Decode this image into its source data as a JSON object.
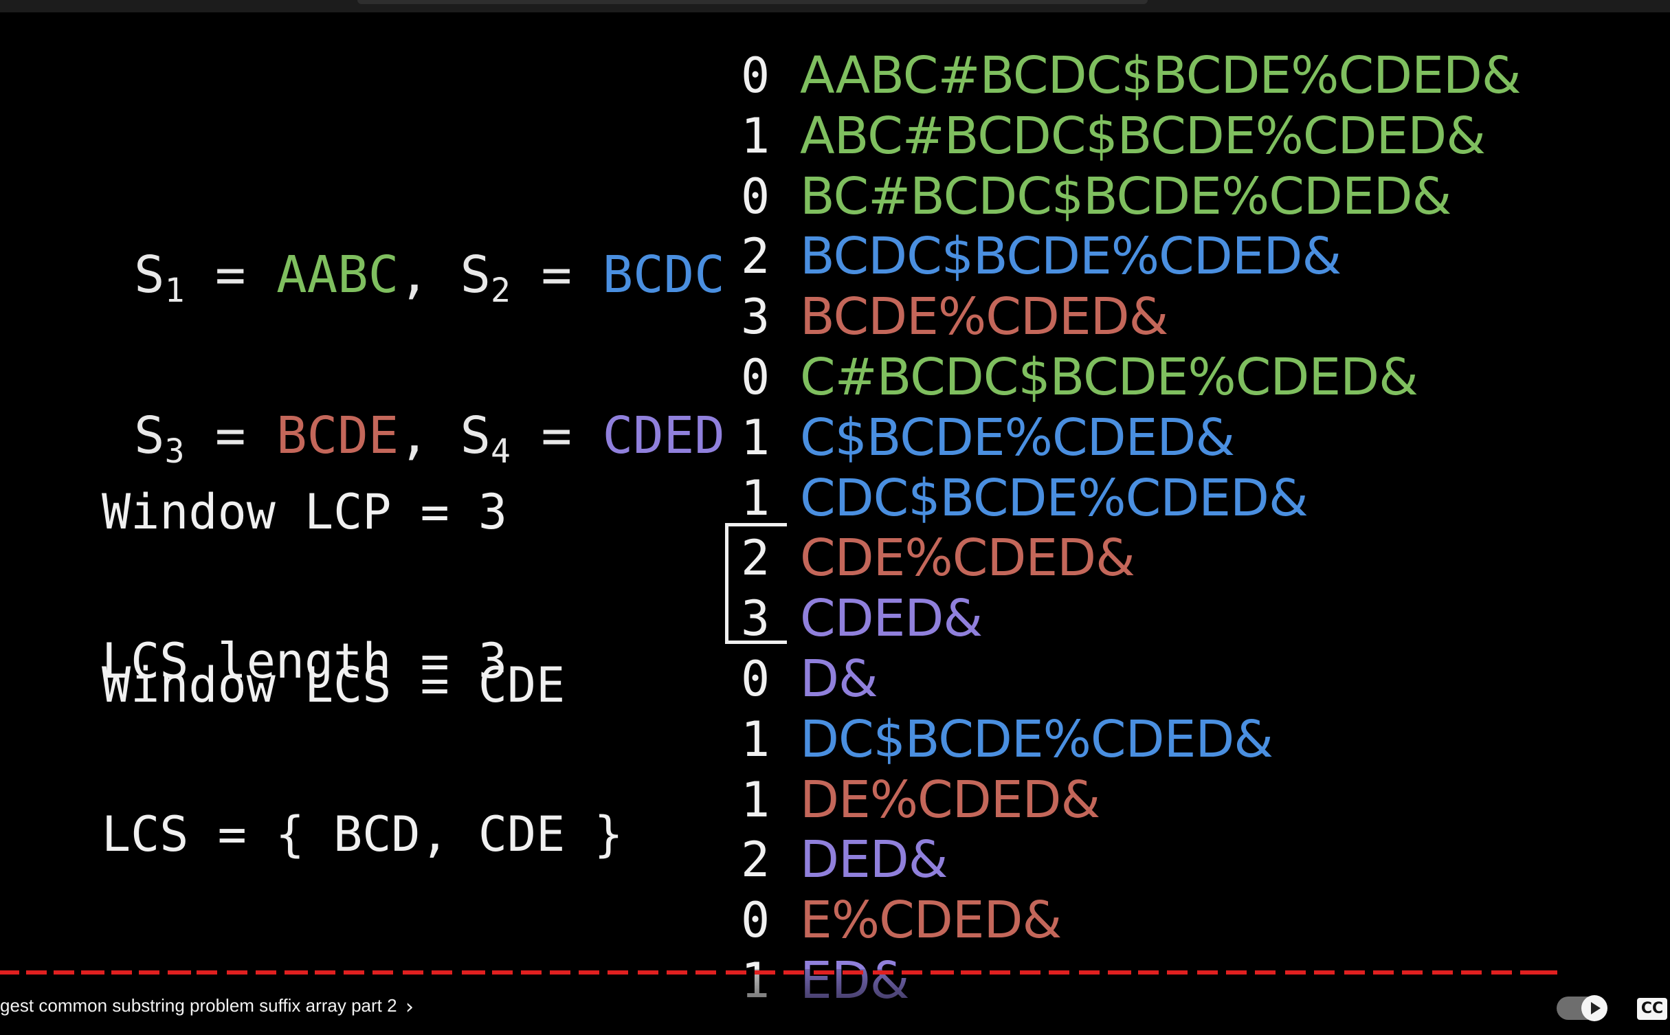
{
  "definitions": [
    {
      "left": {
        "name": "S",
        "index": "1",
        "value": "AABC",
        "color": "#7fbf5f"
      },
      "right": {
        "name": "S",
        "index": "2",
        "value": "BCDC",
        "color": "#4a8fe0"
      }
    },
    {
      "left": {
        "name": "S",
        "index": "3",
        "value": "BCDE",
        "color": "#c4675a"
      },
      "right": {
        "name": "S",
        "index": "4",
        "value": "CDED",
        "color": "#9080dc"
      }
    }
  ],
  "window": {
    "lcp_line": "Window LCP = 3",
    "lcs_line": "Window LCS = CDE"
  },
  "result": {
    "length_line": "LCS length = 3",
    "set_line": "LCS = { BCD, CDE }"
  },
  "suffix_table": [
    {
      "lcp": "0",
      "suffix": "AABC#BCDC$BCDE%CDED&",
      "color": "#7fbf5f"
    },
    {
      "lcp": "1",
      "suffix": "ABC#BCDC$BCDE%CDED&",
      "color": "#7fbf5f"
    },
    {
      "lcp": "0",
      "suffix": "BC#BCDC$BCDE%CDED&",
      "color": "#7fbf5f"
    },
    {
      "lcp": "2",
      "suffix": "BCDC$BCDE%CDED&",
      "color": "#4a8fe0"
    },
    {
      "lcp": "3",
      "suffix": "BCDE%CDED&",
      "color": "#c4675a"
    },
    {
      "lcp": "0",
      "suffix": "C#BCDC$BCDE%CDED&",
      "color": "#7fbf5f"
    },
    {
      "lcp": "1",
      "suffix": "C$BCDE%CDED&",
      "color": "#4a8fe0"
    },
    {
      "lcp": "1",
      "suffix": "CDC$BCDE%CDED&",
      "color": "#4a8fe0"
    },
    {
      "lcp": "2",
      "suffix": "CDE%CDED&",
      "color": "#c4675a"
    },
    {
      "lcp": "3",
      "suffix": "CDED&",
      "color": "#9080dc"
    },
    {
      "lcp": "0",
      "suffix": "D&",
      "color": "#9080dc"
    },
    {
      "lcp": "1",
      "suffix": "DC$BCDE%CDED&",
      "color": "#4a8fe0"
    },
    {
      "lcp": "1",
      "suffix": "DE%CDED&",
      "color": "#c4675a"
    },
    {
      "lcp": "2",
      "suffix": "DED&",
      "color": "#9080dc"
    },
    {
      "lcp": "0",
      "suffix": "E%CDED&",
      "color": "#c4675a"
    },
    {
      "lcp": "1",
      "suffix": "ED&",
      "color": "#9080dc"
    }
  ],
  "player": {
    "title": "gest common substring problem suffix array part 2",
    "chevron": "›",
    "cc_label": "CC",
    "progress_color": "#e02020",
    "autoplay_on": true
  }
}
